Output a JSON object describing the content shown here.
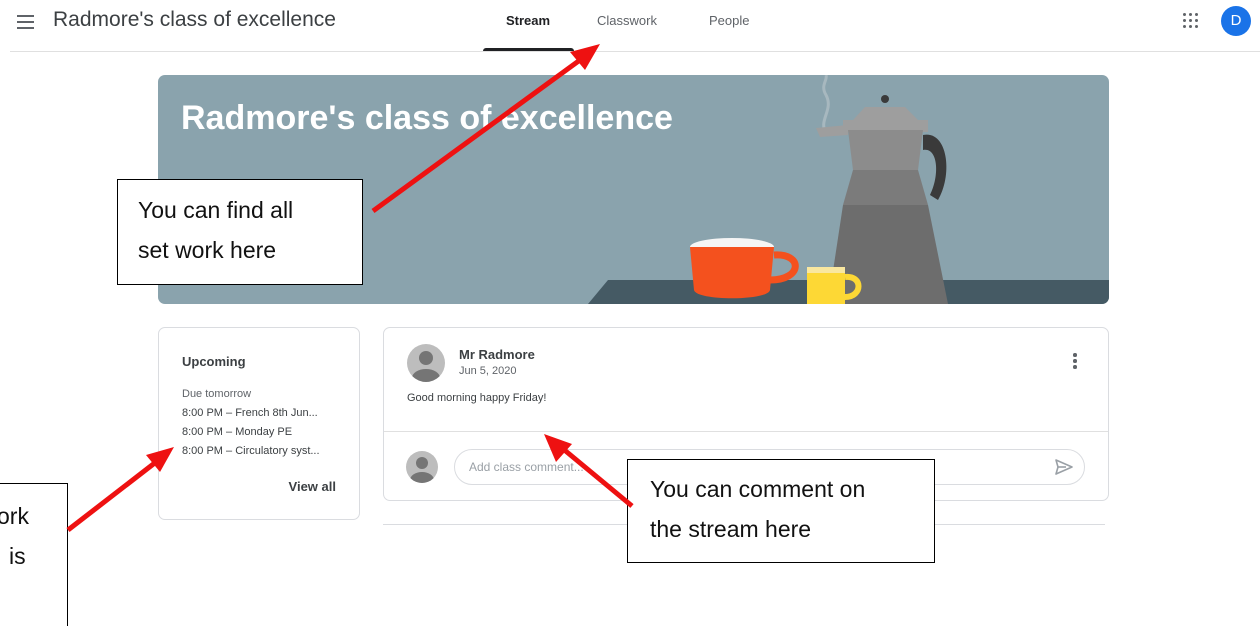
{
  "header": {
    "class_title": "Radmore's class of excellence",
    "tabs": [
      {
        "label": "Stream",
        "active": true
      },
      {
        "label": "Classwork",
        "active": false
      },
      {
        "label": "People",
        "active": false
      }
    ],
    "account_initial": "D"
  },
  "banner": {
    "title": "Radmore's class of excellence"
  },
  "upcoming": {
    "title": "Upcoming",
    "due_label": "Due tomorrow",
    "items": [
      "8:00 PM – French 8th Jun...",
      "8:00 PM – Monday PE",
      "8:00 PM – Circulatory syst..."
    ],
    "view_all": "View all"
  },
  "post": {
    "author": "Mr Radmore",
    "date": "Jun 5, 2020",
    "body": "Good morning happy Friday!",
    "comment_placeholder": "Add class comment..."
  },
  "callouts": {
    "classwork_line1": "You can find all",
    "classwork_line2": "set work here",
    "stream_line1": "You can comment on",
    "stream_line2": "the stream here",
    "upcoming_line1": "ork",
    "upcoming_line2": "is"
  },
  "colors": {
    "banner": "#8aa3ad",
    "accent_avatar": "#1a73e8",
    "arrow": "#ee1111"
  },
  "icons": [
    "menu-icon",
    "apps-grid-icon",
    "more-vert-icon",
    "send-icon",
    "person-icon"
  ]
}
